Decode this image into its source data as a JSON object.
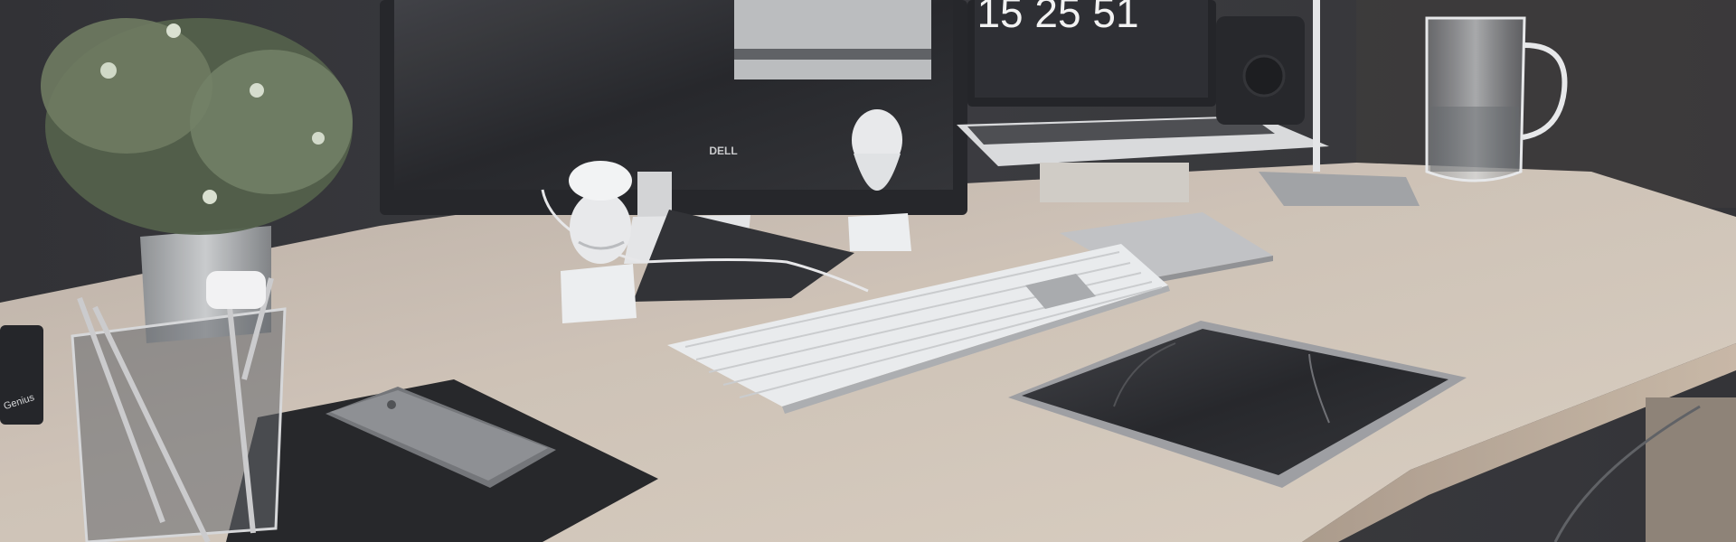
{
  "photo": {
    "clock_time": "15 25 51",
    "monitor_brand": "DELL",
    "device_label": "Genius"
  },
  "colors": {
    "wall": "#2e2f33",
    "desk": "#cbbfb3",
    "desk_edge": "#b9a99a",
    "screen": "#26272c",
    "silver": "#c9cacd",
    "keyboard": "#eef0f2"
  }
}
